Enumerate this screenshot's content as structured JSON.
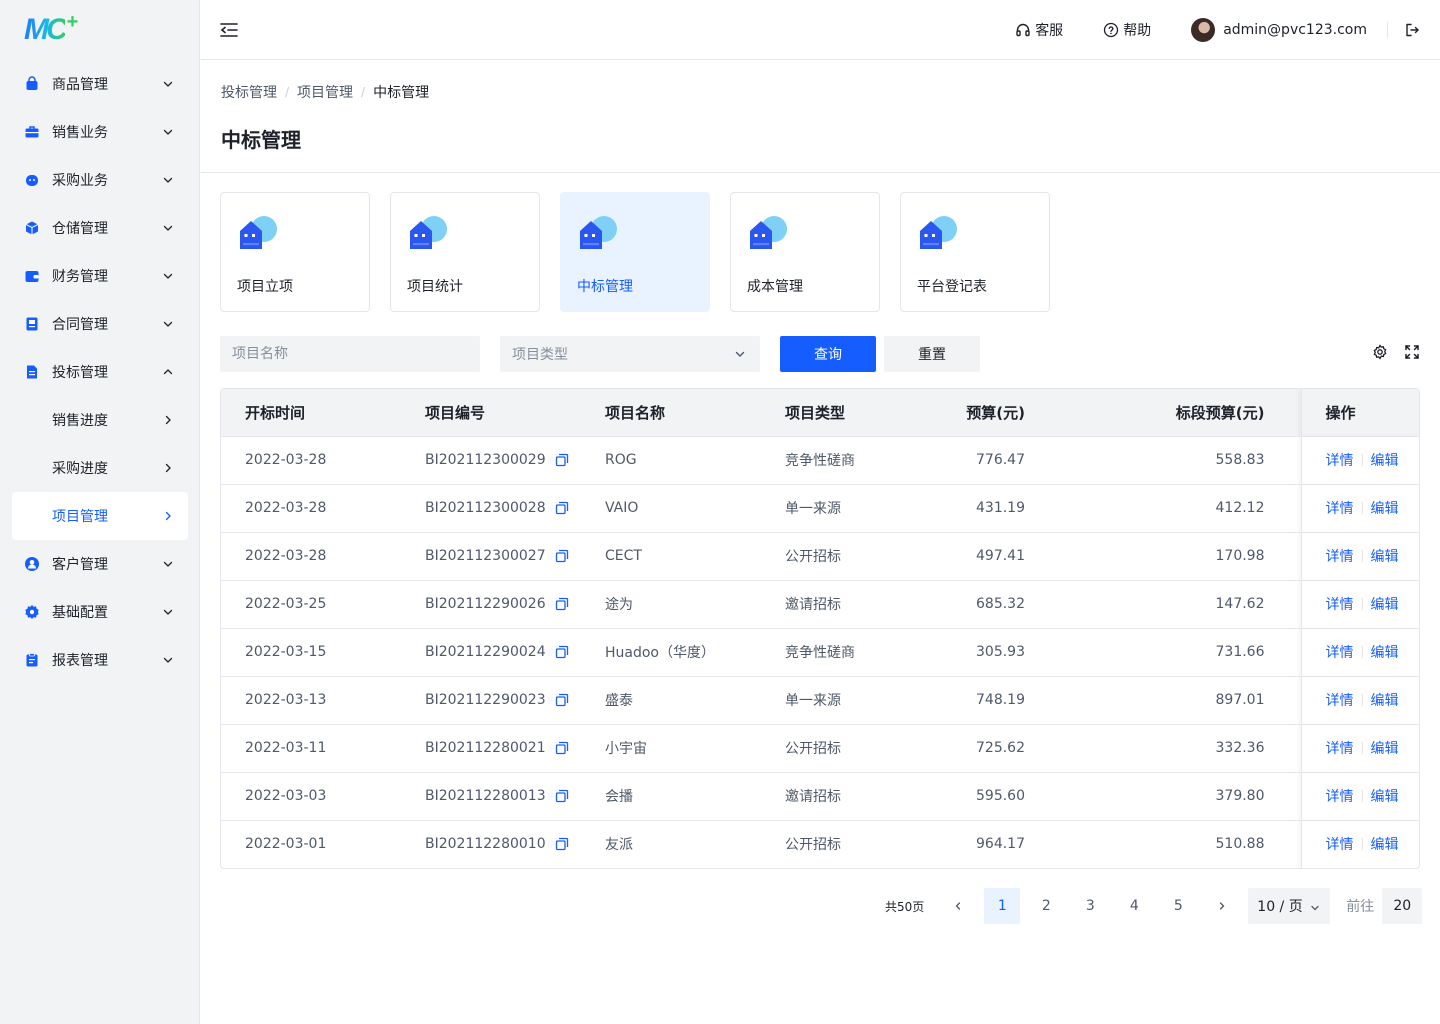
{
  "brand": {
    "logo_text": "MC",
    "logo_plus": "+"
  },
  "sidebar": {
    "items": [
      {
        "label": "商品管理",
        "icon": "bag-icon",
        "chevron": "down"
      },
      {
        "label": "销售业务",
        "icon": "briefcase-icon",
        "chevron": "down"
      },
      {
        "label": "采购业务",
        "icon": "cart-icon",
        "chevron": "down"
      },
      {
        "label": "仓储管理",
        "icon": "box-icon",
        "chevron": "down"
      },
      {
        "label": "财务管理",
        "icon": "wallet-icon",
        "chevron": "down"
      },
      {
        "label": "合同管理",
        "icon": "contract-icon",
        "chevron": "down"
      },
      {
        "label": "投标管理",
        "icon": "bid-doc-icon",
        "chevron": "up"
      },
      {
        "label": "销售进度",
        "sub": true,
        "chevron": "right"
      },
      {
        "label": "采购进度",
        "sub": true,
        "chevron": "right"
      },
      {
        "label": "项目管理",
        "sub": true,
        "chevron": "right",
        "active": true
      },
      {
        "label": "客户管理",
        "icon": "user-icon",
        "chevron": "down"
      },
      {
        "label": "基础配置",
        "icon": "gear-icon",
        "chevron": "down"
      },
      {
        "label": "报表管理",
        "icon": "report-icon",
        "chevron": "down"
      }
    ]
  },
  "header": {
    "support_label": "客服",
    "help_label": "帮助",
    "user_email": "admin@pvc123.com"
  },
  "breadcrumb": [
    "投标管理",
    "项目管理",
    "中标管理"
  ],
  "page_title": "中标管理",
  "cards": [
    {
      "label": "项目立项",
      "active": false
    },
    {
      "label": "项目统计",
      "active": false
    },
    {
      "label": "中标管理",
      "active": true
    },
    {
      "label": "成本管理",
      "active": false
    },
    {
      "label": "平台登记表",
      "active": false
    }
  ],
  "filters": {
    "name_placeholder": "项目名称",
    "type_placeholder": "项目类型",
    "query_label": "查询",
    "reset_label": "重置"
  },
  "table": {
    "columns": [
      "开标时间",
      "项目编号",
      "项目名称",
      "项目类型",
      "预算(元)",
      "标段预算(元)",
      "操作"
    ],
    "rows": [
      {
        "date": "2022-03-28",
        "code": "BI202112300029",
        "name": "ROG",
        "type": "竞争性磋商",
        "budget": "776.47",
        "section_budget": "558.83"
      },
      {
        "date": "2022-03-28",
        "code": "BI202112300028",
        "name": "VAIO",
        "type": "单一来源",
        "budget": "431.19",
        "section_budget": "412.12"
      },
      {
        "date": "2022-03-28",
        "code": "BI202112300027",
        "name": "CECT",
        "type": "公开招标",
        "budget": "497.41",
        "section_budget": "170.98"
      },
      {
        "date": "2022-03-25",
        "code": "BI202112290026",
        "name": "途为",
        "type": "邀请招标",
        "budget": "685.32",
        "section_budget": "147.62"
      },
      {
        "date": "2022-03-15",
        "code": "BI202112290024",
        "name": "Huadoo（华度）",
        "type": "竞争性磋商",
        "budget": "305.93",
        "section_budget": "731.66"
      },
      {
        "date": "2022-03-13",
        "code": "BI202112290023",
        "name": "盛泰",
        "type": "单一来源",
        "budget": "748.19",
        "section_budget": "897.01"
      },
      {
        "date": "2022-03-11",
        "code": "BI202112280021",
        "name": "小宇宙",
        "type": "公开招标",
        "budget": "725.62",
        "section_budget": "332.36"
      },
      {
        "date": "2022-03-03",
        "code": "BI202112280013",
        "name": "会播",
        "type": "邀请招标",
        "budget": "595.60",
        "section_budget": "379.80"
      },
      {
        "date": "2022-03-01",
        "code": "BI202112280010",
        "name": "友派",
        "type": "公开招标",
        "budget": "964.17",
        "section_budget": "510.88"
      }
    ],
    "detail_label": "详情",
    "edit_label": "编辑"
  },
  "pagination": {
    "total_label": "共50页",
    "pages": [
      "1",
      "2",
      "3",
      "4",
      "5"
    ],
    "current": "1",
    "page_size_label": "10 / 页",
    "goto_label": "前往",
    "goto_value": "20"
  },
  "colors": {
    "primary": "#165dff",
    "sidebar_bg": "#f2f3f5",
    "border": "#e5e6eb",
    "text": "#1d2129",
    "text_secondary": "#4e5969",
    "placeholder": "#86909c",
    "card_active_bg": "#e8f3ff"
  }
}
